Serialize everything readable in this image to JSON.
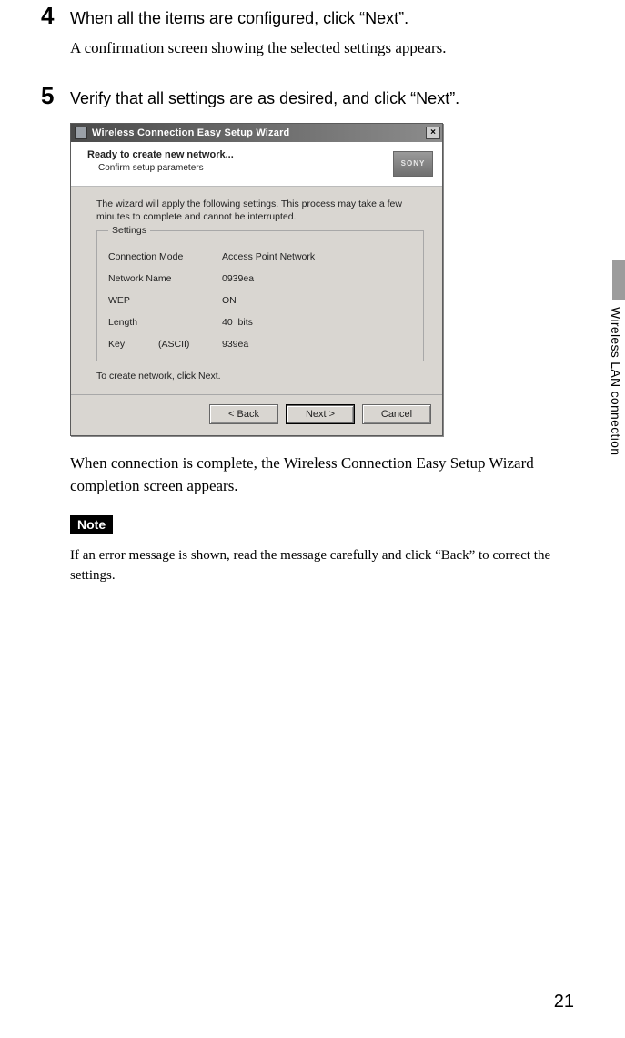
{
  "step4": {
    "num": "4",
    "title": "When all the items are configured, click “Next”.",
    "body": "A confirmation screen showing the selected settings appears."
  },
  "step5": {
    "num": "5",
    "title": "Verify that all settings are as desired, and click “Next”."
  },
  "dialog": {
    "window_title": "Wireless Connection Easy Setup Wizard",
    "close_glyph": "×",
    "header_title": "Ready to create new network...",
    "header_sub": "Confirm setup parameters",
    "logo": "SONY",
    "info": "The wizard will apply the following settings. This process may take a few minutes to complete and cannot be interrupted.",
    "settings_legend": "Settings",
    "rows": {
      "mode_label": "Connection Mode",
      "mode_value": "Access Point Network",
      "name_label": "Network Name",
      "name_value": "0939ea",
      "wep_label": "WEP",
      "wep_value": "ON",
      "length_label": "Length",
      "length_value": "40",
      "length_unit": "bits",
      "key_label": "Key",
      "key_sub": "(ASCII)",
      "key_value": "939ea"
    },
    "create_text": "To create network, click Next.",
    "buttons": {
      "back": "< Back",
      "next": "Next >",
      "cancel": "Cancel"
    }
  },
  "after_dialog": "When connection is complete, the Wireless Connection Easy Setup Wizard completion screen appears.",
  "note_label": "Note",
  "note_text": "If an error message is shown, read the message carefully and click “Back” to correct the settings.",
  "side_tab": "Wireless LAN connection",
  "page_number": "21"
}
